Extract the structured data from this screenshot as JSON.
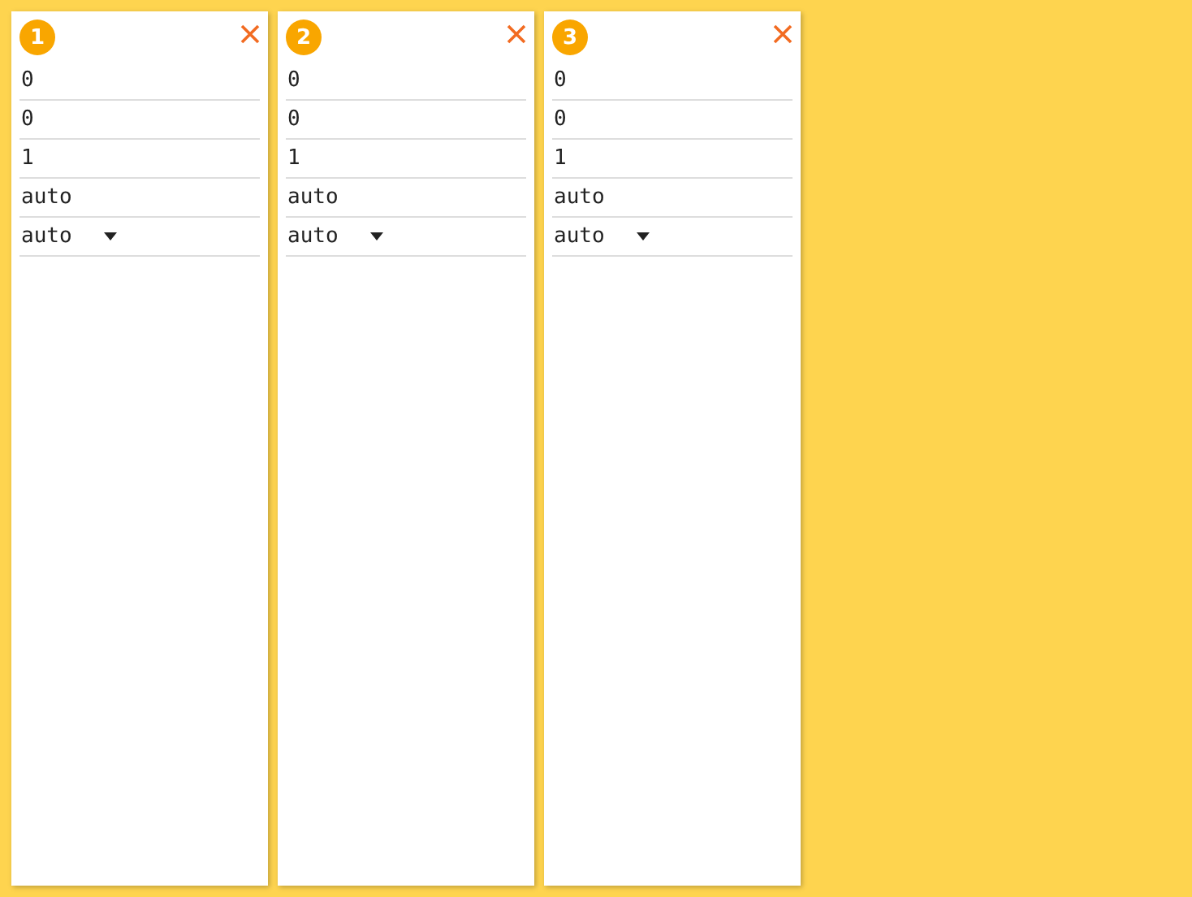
{
  "cards": [
    {
      "number": "1",
      "fields": [
        {
          "kind": "input",
          "value": "0"
        },
        {
          "kind": "input",
          "value": "0"
        },
        {
          "kind": "input",
          "value": "1"
        },
        {
          "kind": "input",
          "value": "auto"
        },
        {
          "kind": "select",
          "value": "auto"
        }
      ]
    },
    {
      "number": "2",
      "fields": [
        {
          "kind": "input",
          "value": "0"
        },
        {
          "kind": "input",
          "value": "0"
        },
        {
          "kind": "input",
          "value": "1"
        },
        {
          "kind": "input",
          "value": "auto"
        },
        {
          "kind": "select",
          "value": "auto"
        }
      ]
    },
    {
      "number": "3",
      "fields": [
        {
          "kind": "input",
          "value": "0"
        },
        {
          "kind": "input",
          "value": "0"
        },
        {
          "kind": "input",
          "value": "1"
        },
        {
          "kind": "input",
          "value": "auto"
        },
        {
          "kind": "select",
          "value": "auto"
        }
      ]
    }
  ]
}
